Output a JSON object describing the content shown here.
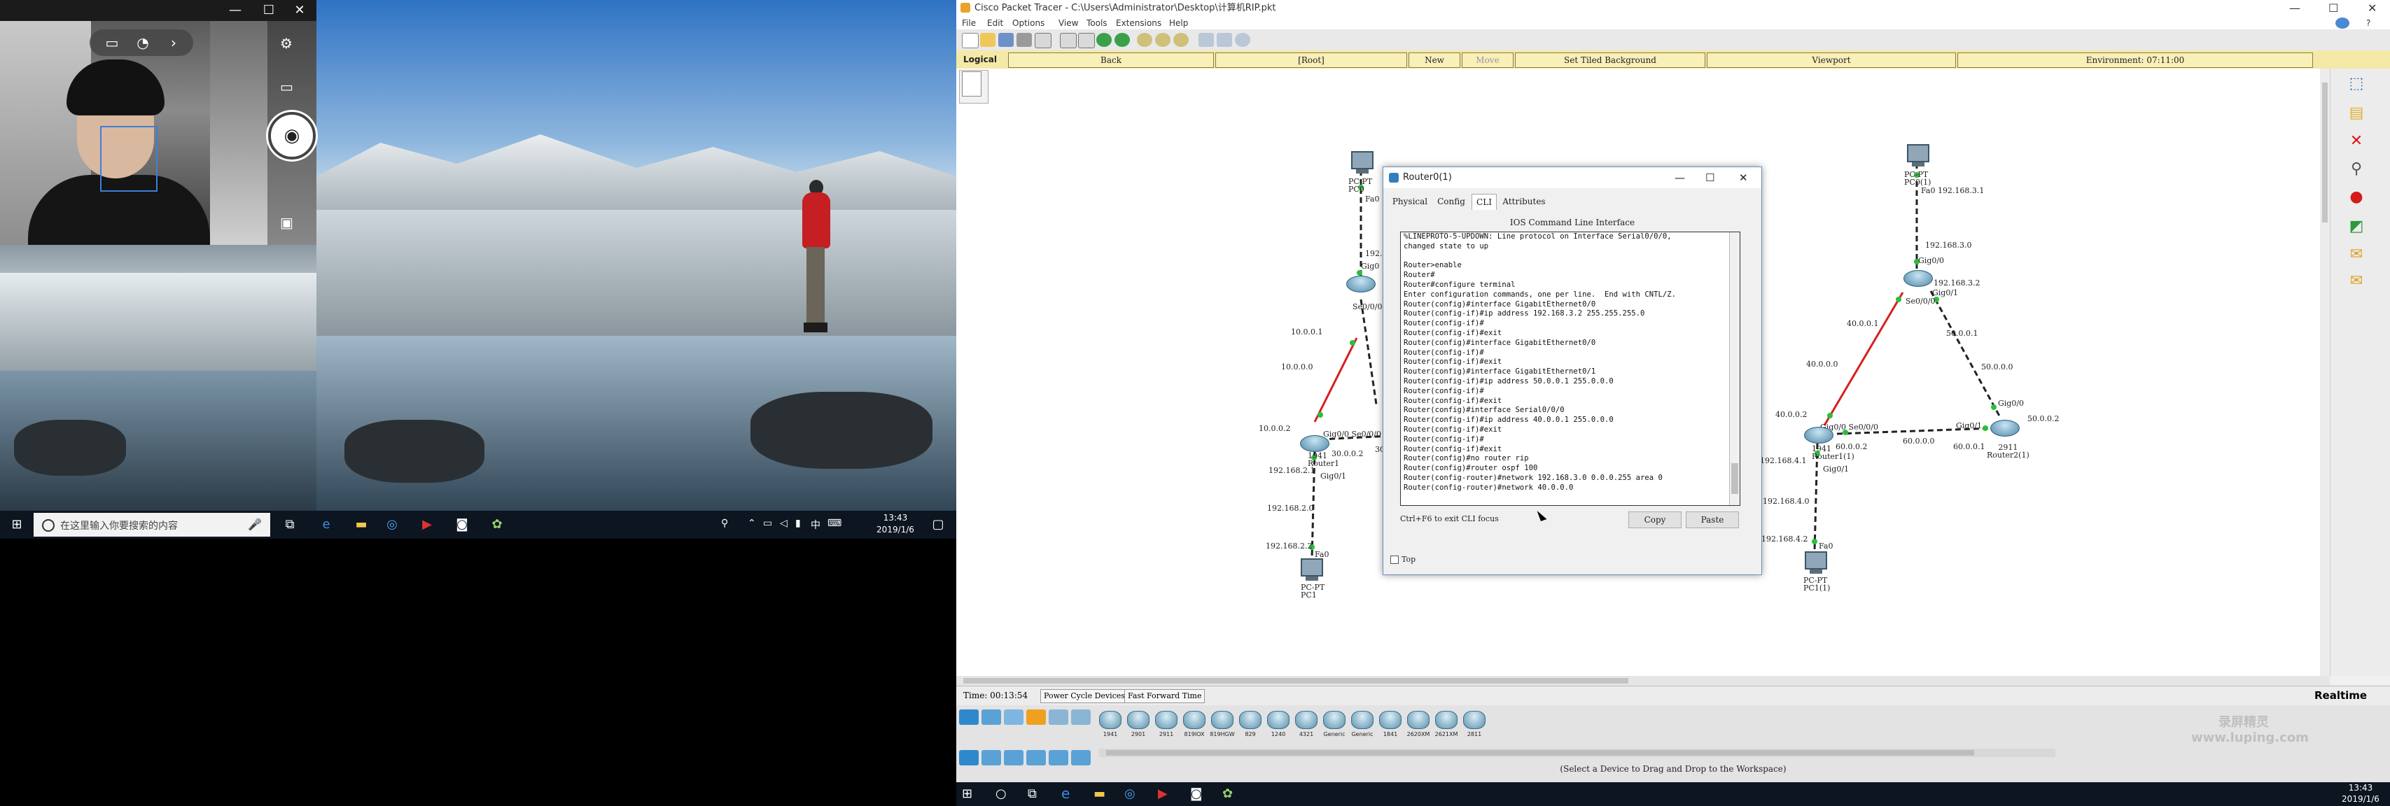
{
  "left": {
    "camera": {
      "window_controls": [
        "—",
        "☐",
        "✕"
      ],
      "toolbar_icons": [
        "video-mode-icon",
        "hdr-timer-icon",
        "chevron-right-icon"
      ],
      "side_icons": [
        "settings-icon",
        "video-icon",
        "camera-shutter-icon",
        "gallery-icon"
      ]
    },
    "taskbar": {
      "search_placeholder": "在这里输入你要搜索的内容",
      "time": "13:43",
      "date": "2019/1/6"
    }
  },
  "pt": {
    "title": "Cisco Packet Tracer - C:\\Users\\Administrator\\Desktop\\计算机RIP.pkt",
    "menu": [
      "File",
      "Edit",
      "Options",
      "View",
      "Tools",
      "Extensions",
      "Help"
    ],
    "nav": {
      "logical": "Logical",
      "back": "Back",
      "root": "[Root]",
      "new_cluster": "New Cluster",
      "move_object": "Move Object",
      "tiled_background": "Set Tiled Background",
      "viewport": "Viewport",
      "environment": "Environment: 07:11:00"
    },
    "topology": {
      "pc_top_left": "PC-PT\nPC0",
      "pc_top_left_port": "Fa0",
      "r_top_left_port": "192.",
      "r_top_left_port2": "Gig0",
      "r_top_left_sa": "Se0/0/0",
      "l1": "10.0.0.1",
      "l2": "10.0.0.0",
      "l3": "10.0.0.2",
      "r1_port": "Gig0/0 Se0/0/0",
      "r1_name": "1941\nRouter1",
      "r1_ip": "30.0.0.2",
      "r1_ip2": "30.0.0.",
      "r1_gig01": "Gig0/1",
      "r1_net1": "192.168.2.1",
      "r1_net2": "192.168.2.0",
      "r1_net3": "192.168.2.2",
      "pc1_port": "Fa0",
      "pc1_name": "PC-PT\nPC1",
      "pc_top_right": "PC-PT\nPC0(1)",
      "pc_top_right_ip": "Fa0 192.168.3.1",
      "tr_net": "192.168.3.0",
      "tr_gig00": "Gig0/0",
      "tr_ip": "192.168.3.2",
      "tr_gig01": "Gig0/1",
      "tr_sa": "Se0/0/0",
      "r_l1": "40.0.0.1",
      "r_l2": "40.0.0.0",
      "r_l3": "40.0.0.2",
      "r_50_1": "50.0.0.1",
      "r_50_0": "50.0.0.0",
      "r_50_2": "50.0.0.2",
      "r_gig00": "Gig0/0",
      "r_gig01": "Gig0/1",
      "r_60_2": "60.0.0.2",
      "r_60_0": "60.0.0.0",
      "r_60_1": "60.0.0.1",
      "rr_name": "2911\nRouter2(1)",
      "rm_port": "Gig0/0 Se0/0/0",
      "rm_name": "1941\nRouter1(1)",
      "rm_gig01": "Gig0/1",
      "rm_net1": "192.168.4.1",
      "rm_net2": "192.168.4.0",
      "rm_net3": "192.168.4.2",
      "pc11_port": "Fa0",
      "pc11_name": "PC-PT\nPC1(1)"
    },
    "cli": {
      "title": "Router0(1)",
      "tabs": [
        "Physical",
        "Config",
        "CLI",
        "Attributes"
      ],
      "heading": "IOS Command Line Interface",
      "lines": [
        "%LINEPROTO-5-UPDOWN: Line protocol on Interface Serial0/0/0,",
        "changed state to up",
        "",
        "Router>enable",
        "Router#",
        "Router#configure terminal",
        "Enter configuration commands, one per line.  End with CNTL/Z.",
        "Router(config)#interface GigabitEthernet0/0",
        "Router(config-if)#ip address 192.168.3.2 255.255.255.0",
        "Router(config-if)#",
        "Router(config-if)#exit",
        "Router(config)#interface GigabitEthernet0/0",
        "Router(config-if)#",
        "Router(config-if)#exit",
        "Router(config)#interface GigabitEthernet0/1",
        "Router(config-if)#ip address 50.0.0.1 255.0.0.0",
        "Router(config-if)#",
        "Router(config-if)#exit",
        "Router(config)#interface Serial0/0/0",
        "Router(config-if)#ip address 40.0.0.1 255.0.0.0",
        "Router(config-if)#exit",
        "Router(config-if)#",
        "Router(config-if)#exit",
        "Router(config)#no router rip",
        "Router(config)#router ospf 100",
        "Router(config-router)#network 192.168.3.0 0.0.0.255 area 0",
        "Router(config-router)#network 40.0.0.0"
      ],
      "hint": "Ctrl+F6 to exit CLI focus",
      "copy": "Copy",
      "paste": "Paste",
      "top_label": "Top"
    },
    "status": {
      "time": "Time: 00:13:54",
      "power_cycle": "Power Cycle Devices",
      "fast_forward": "Fast Forward Time",
      "realtime": "Realtime"
    },
    "device_list": [
      "1941",
      "2901",
      "2911",
      "819IOX",
      "819HGW",
      "829",
      "1240",
      "4321",
      "Generic",
      "Generic",
      "1841",
      "2620XM",
      "2621XM",
      "2811"
    ],
    "drag_hint": "(Select a Device to Drag and Drop to the Workspace)",
    "watermark": "录屏精灵 www.luping.com",
    "taskbar": {
      "time": "13:43",
      "date": "2019/1/6"
    }
  }
}
